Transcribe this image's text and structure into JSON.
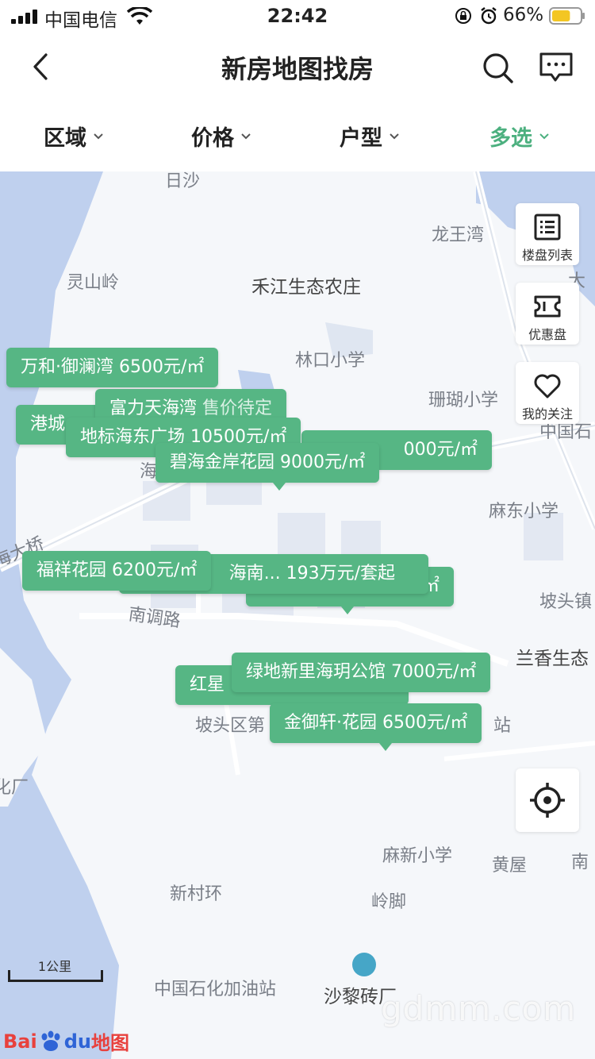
{
  "status_bar": {
    "carrier": "中国电信",
    "time": "22:42",
    "battery_percent": "66%",
    "battery_level": 0.66,
    "battery_color": "#f3c623"
  },
  "nav": {
    "title": "新房地图找房",
    "back_icon": "chevron-left-icon",
    "search_icon": "search-icon",
    "message_icon": "message-icon"
  },
  "filters": [
    {
      "label": "区域",
      "active": false
    },
    {
      "label": "价格",
      "active": false
    },
    {
      "label": "户型",
      "active": false
    },
    {
      "label": "多选",
      "active": true
    }
  ],
  "accent_color": "#4cb07f",
  "label_color": "#56b684",
  "side_buttons": [
    {
      "label": "楼盘列表",
      "icon": "list-icon"
    },
    {
      "label": "优惠盘",
      "icon": "ticket-icon"
    },
    {
      "label": "我的关注",
      "icon": "heart-icon"
    }
  ],
  "map_places": [
    "日沙",
    "龙王湾",
    "灵山岭",
    "禾江生态农庄",
    "大",
    "林口小学",
    "珊瑚小学",
    "中国石",
    "海",
    "麻东小学",
    "海大桥",
    "南调路",
    "坡头镇",
    "兰香生态",
    "坡头区第",
    "站",
    "化厂",
    "麻新小学",
    "黄屋",
    "南",
    "新村环",
    "岭脚",
    "中国石化加油站",
    "沙黎砖厂"
  ],
  "property_labels": [
    {
      "text": "万和·御澜湾 6500元/㎡"
    },
    {
      "text": "港城"
    },
    {
      "name": "富力天海湾",
      "status": "售价待定"
    },
    {
      "text": "地标海东广场 10500元/㎡"
    },
    {
      "text": "000元/㎡"
    },
    {
      "text": "碧海金岸花园 9000元/㎡"
    },
    {
      "text": "福祥花园 6200元/㎡"
    },
    {
      "text": "/㎡"
    },
    {
      "text": "海南... 193万元/套起"
    },
    {
      "text": "红星"
    },
    {
      "text": "绿地新里海玥公馆 7000元/㎡"
    },
    {
      "text": "金御轩·花园 6500元/㎡"
    }
  ],
  "scale": "1公里",
  "logo": {
    "text1": "Bai",
    "text2": "du",
    "text3": "地图"
  },
  "watermark": "gdmm.com"
}
